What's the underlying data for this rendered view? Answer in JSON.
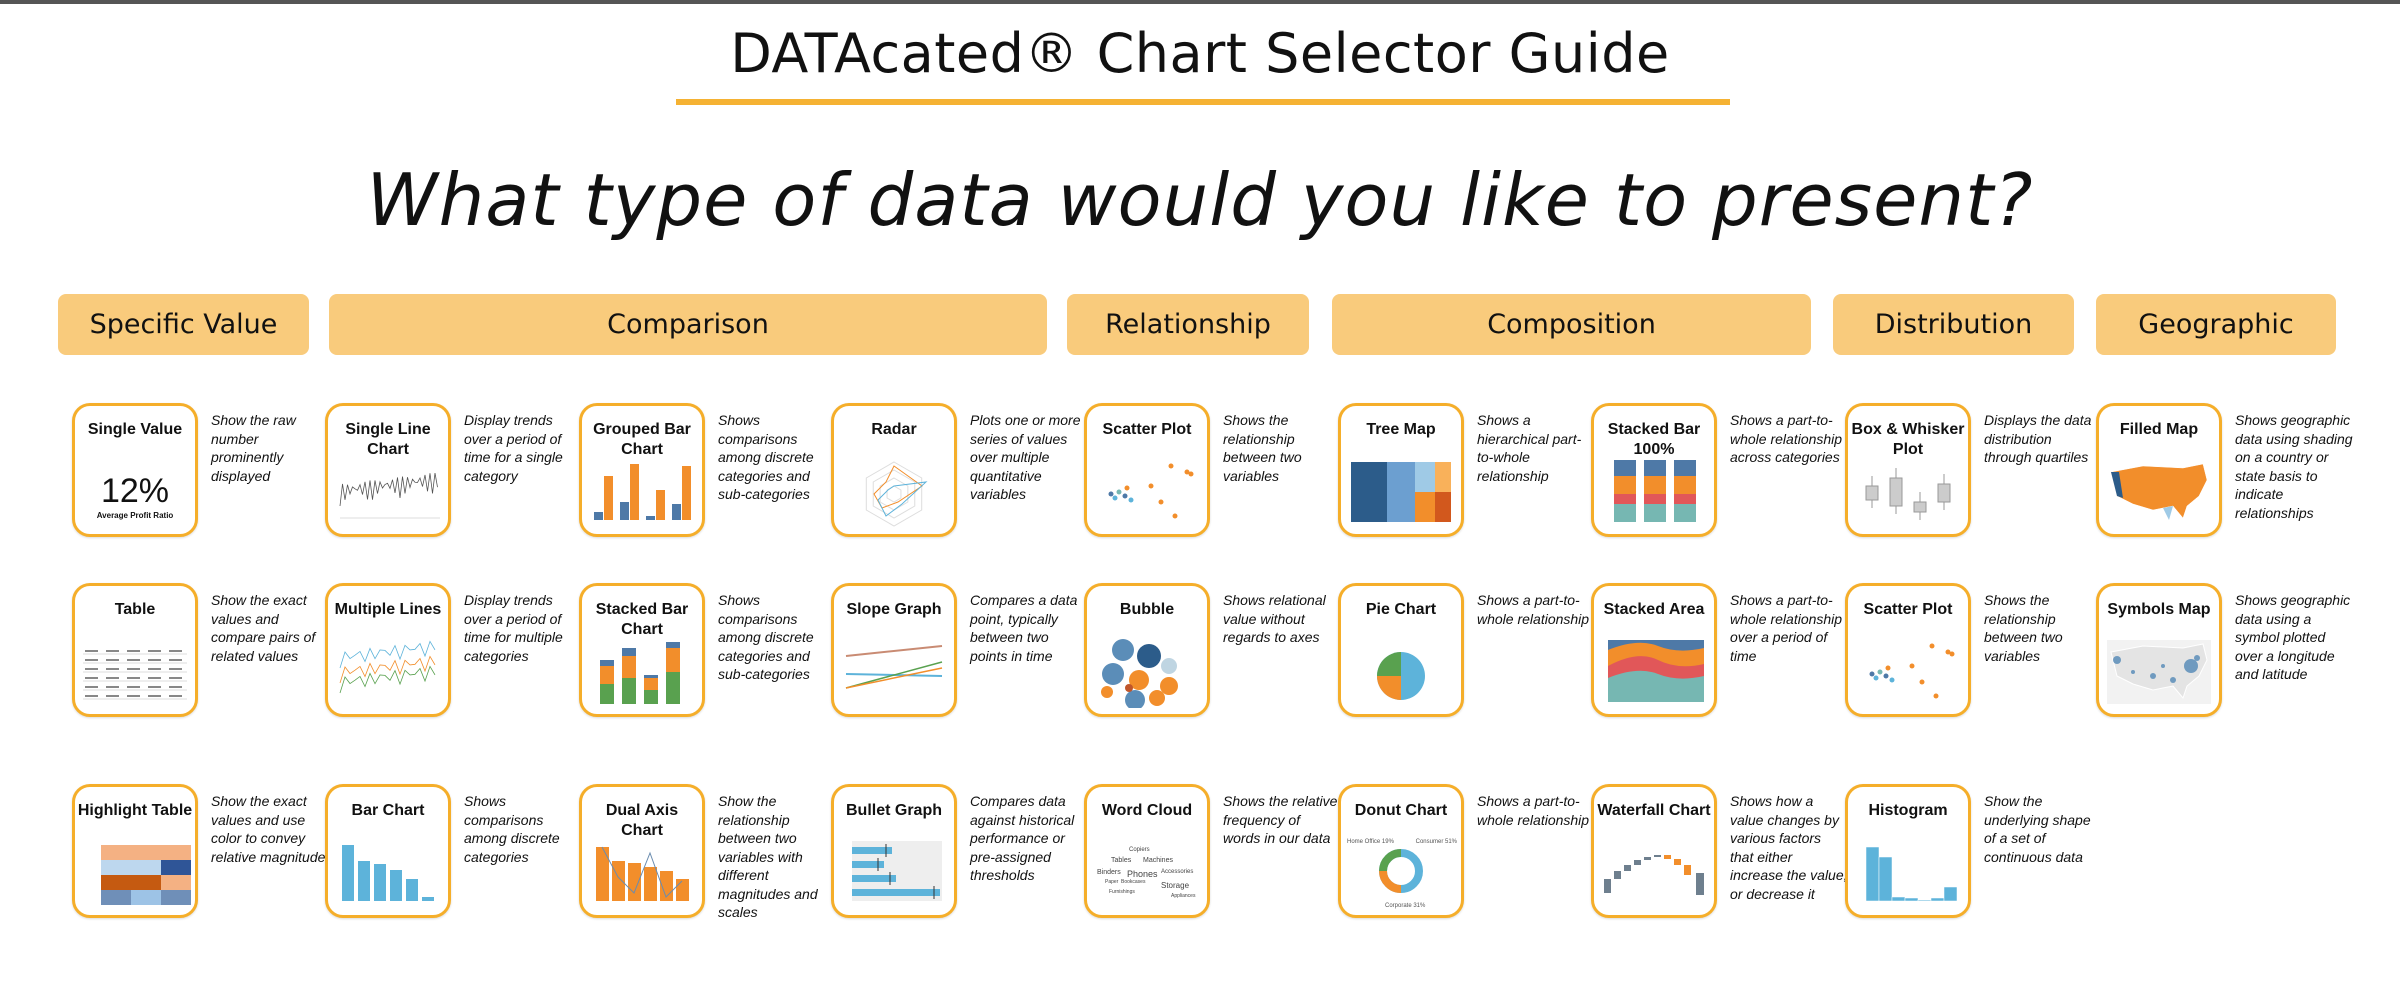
{
  "header": {
    "title": "DATAcated® Chart Selector Guide",
    "question": "What type of data would you like to present?",
    "accent_color": "#F5B233",
    "category_color": "#F9CB7C",
    "card_border_color": "#F5AE2A"
  },
  "categories": [
    {
      "label": "Specific Value"
    },
    {
      "label": "Comparison"
    },
    {
      "label": "Relationship"
    },
    {
      "label": "Composition"
    },
    {
      "label": "Distribution"
    },
    {
      "label": "Geographic"
    }
  ],
  "cards": [
    {
      "title": "Single Value",
      "desc": "Show the raw number prominently displayed",
      "thumb": "single-value",
      "value": "12%",
      "caption": "Average Profit Ratio"
    },
    {
      "title": "Table",
      "desc": "Show the exact values and compare pairs of related values",
      "thumb": "table"
    },
    {
      "title": "Highlight Table",
      "desc": "Show the exact values and use color to convey relative magnitude",
      "thumb": "highlight-table"
    },
    {
      "title": "Single Line Chart",
      "desc": "Display trends over a period of time for a single category",
      "thumb": "line"
    },
    {
      "title": "Multiple Lines",
      "desc": "Display trends over a period of time for multiple categories",
      "thumb": "multi-line"
    },
    {
      "title": "Bar Chart",
      "desc": "Shows comparisons among discrete categories",
      "thumb": "bar"
    },
    {
      "title": "Grouped Bar Chart",
      "desc": "Shows comparisons among discrete categories and sub-categories",
      "thumb": "grouped-bar"
    },
    {
      "title": "Stacked Bar Chart",
      "desc": "Shows comparisons among discrete categories and sub-categories",
      "thumb": "stacked-bar"
    },
    {
      "title": "Dual Axis Chart",
      "desc": "Show the relationship between two variables with different magnitudes and scales",
      "thumb": "dual-axis"
    },
    {
      "title": "Radar",
      "desc": "Plots one or more series of values over multiple quantitative variables",
      "thumb": "radar"
    },
    {
      "title": "Slope Graph",
      "desc": "Compares a data point, typically between two points in time",
      "thumb": "slope"
    },
    {
      "title": "Bullet Graph",
      "desc": "Compares data against historical performance or pre-assigned thresholds",
      "thumb": "bullet"
    },
    {
      "title": "Scatter Plot",
      "desc": "Shows the relationship between two variables",
      "thumb": "scatter"
    },
    {
      "title": "Bubble",
      "desc": "Shows relational value without regards to axes",
      "thumb": "bubble"
    },
    {
      "title": "Word Cloud",
      "desc": "Shows the relative frequency of words in our data",
      "thumb": "word-cloud",
      "words": [
        "Copiers",
        "Tables",
        "Machines",
        "Binders",
        "Phones",
        "Accessories",
        "Paper",
        "Bookcases",
        "Storage",
        "Furnishings",
        "Appliances"
      ]
    },
    {
      "title": "Tree Map",
      "desc": "Shows a hierarchical part-to-whole relationship",
      "thumb": "treemap"
    },
    {
      "title": "Pie Chart",
      "desc": "Shows a part-to-whole relationship",
      "thumb": "pie"
    },
    {
      "title": "Donut Chart",
      "desc": "Shows a part-to-whole relationship",
      "thumb": "donut",
      "labels": [
        "Home Office 19%",
        "Consumer 51%",
        "Corporate 31%"
      ]
    },
    {
      "title": "Stacked Bar 100%",
      "desc": "Shows a part-to-whole relationship across categories",
      "thumb": "stacked-100"
    },
    {
      "title": "Stacked Area",
      "desc": "Shows a part-to-whole relationship over a period of time",
      "thumb": "stacked-area"
    },
    {
      "title": "Waterfall Chart",
      "desc": "Shows how a value changes by various factors that either increase the value, or decrease it",
      "thumb": "waterfall"
    },
    {
      "title": "Box & Whisker Plot",
      "desc": "Displays the data distribution through quartiles",
      "thumb": "box"
    },
    {
      "title": "Scatter Plot",
      "desc": "Shows the relationship between two variables",
      "thumb": "scatter"
    },
    {
      "title": "Histogram",
      "desc": "Show the underlying shape of a set of continuous data",
      "thumb": "histogram"
    },
    {
      "title": "Filled Map",
      "desc": "Shows geographic data using shading on a country or state basis to indicate relationships",
      "thumb": "filled-map"
    },
    {
      "title": "Symbols Map",
      "desc": "Shows geographic data using a symbol plotted over a longitude and latitude",
      "thumb": "symbols-map"
    }
  ]
}
